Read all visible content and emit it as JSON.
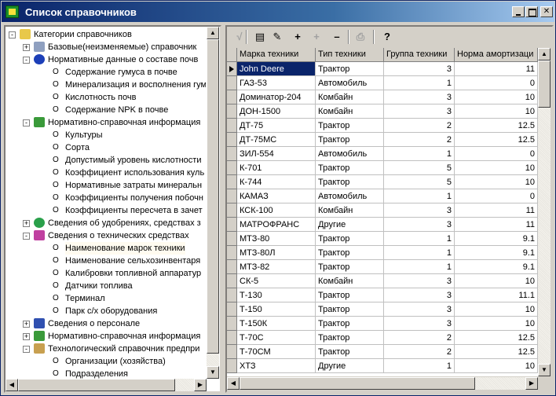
{
  "window": {
    "title": "Список справочников"
  },
  "tree": {
    "rows": [
      {
        "text": "Категории справочников",
        "level": 0,
        "exp": "-",
        "icon": "folder-open-icon"
      },
      {
        "text": "Базовые(неизменяемые) справочник",
        "level": 1,
        "exp": "+",
        "icon": "stack-icon"
      },
      {
        "text": "Нормативные данные о составе почв",
        "level": 1,
        "exp": "-",
        "icon": "drop-icon"
      },
      {
        "text": "Содержание гумуса в почве",
        "level": 2,
        "exp": "",
        "icon": ""
      },
      {
        "text": "Минерализация и восполнения гум",
        "level": 2,
        "exp": "",
        "icon": ""
      },
      {
        "text": "Кислотность почв",
        "level": 2,
        "exp": "",
        "icon": ""
      },
      {
        "text": "Содержание NPK в почве",
        "level": 2,
        "exp": "",
        "icon": ""
      },
      {
        "text": "Нормативно-справочная информация",
        "level": 1,
        "exp": "-",
        "icon": "plant-icon"
      },
      {
        "text": "Культуры",
        "level": 2,
        "exp": "",
        "icon": ""
      },
      {
        "text": "Сорта",
        "level": 2,
        "exp": "",
        "icon": ""
      },
      {
        "text": "Допустимый уровень кислотности",
        "level": 2,
        "exp": "",
        "icon": ""
      },
      {
        "text": "Коэффициент использования куль",
        "level": 2,
        "exp": "",
        "icon": ""
      },
      {
        "text": "Нормативные затраты минеральн",
        "level": 2,
        "exp": "",
        "icon": ""
      },
      {
        "text": "Коэффициенты получения побочн",
        "level": 2,
        "exp": "",
        "icon": ""
      },
      {
        "text": "Коэффициенты пересчета в зачет",
        "level": 2,
        "exp": "",
        "icon": ""
      },
      {
        "text": "Сведения об удобрениях, средствах з",
        "level": 1,
        "exp": "+",
        "icon": "green-drop-icon"
      },
      {
        "text": "Сведения о технических средствах",
        "level": 1,
        "exp": "-",
        "icon": "car-icon"
      },
      {
        "text": "Наименование марок техники",
        "level": 2,
        "exp": "",
        "icon": "",
        "highlight": true
      },
      {
        "text": "Наименование сельхозинвентаря",
        "level": 2,
        "exp": "",
        "icon": ""
      },
      {
        "text": "Калибровки топливной аппаратур",
        "level": 2,
        "exp": "",
        "icon": ""
      },
      {
        "text": "Датчики топлива",
        "level": 2,
        "exp": "",
        "icon": ""
      },
      {
        "text": "Терминал",
        "level": 2,
        "exp": "",
        "icon": ""
      },
      {
        "text": "Парк с/х оборудования",
        "level": 2,
        "exp": "",
        "icon": ""
      },
      {
        "text": "Сведения о персонале",
        "level": 1,
        "exp": "+",
        "icon": "person-icon"
      },
      {
        "text": "Нормативно-справочная информация",
        "level": 1,
        "exp": "+",
        "icon": "plant-pot-icon"
      },
      {
        "text": "Технологический справочник предпри",
        "level": 1,
        "exp": "-",
        "icon": "house-icon"
      },
      {
        "text": "Организации (хозяйства)",
        "level": 2,
        "exp": "",
        "icon": ""
      },
      {
        "text": "Подразделения",
        "level": 2,
        "exp": "",
        "icon": ""
      }
    ]
  },
  "toolbar": {
    "buttons": [
      {
        "name": "check-icon",
        "glyph": "√",
        "enabled": false
      },
      {
        "name": "list-icon",
        "glyph": "▤",
        "enabled": true
      },
      {
        "name": "edit-icon",
        "glyph": "✎",
        "enabled": true
      },
      {
        "name": "add-icon",
        "glyph": "+",
        "enabled": true
      },
      {
        "name": "add-copy-icon",
        "glyph": "+",
        "enabled": false
      },
      {
        "name": "delete-icon",
        "glyph": "–",
        "enabled": true
      },
      {
        "name": "print-icon",
        "glyph": "⎙",
        "enabled": false
      },
      {
        "name": "help-icon",
        "glyph": "?",
        "enabled": true
      }
    ]
  },
  "grid": {
    "columns": [
      "Марка техники",
      "Тип техники",
      "Группа техники",
      "Норма амортизаци"
    ],
    "rows": [
      [
        "John Deere",
        "Трактор",
        "3",
        "11"
      ],
      [
        "ГАЗ-53",
        "Автомобиль",
        "1",
        "0"
      ],
      [
        "Доминатор-204",
        "Комбайн",
        "3",
        "10"
      ],
      [
        "ДОН-1500",
        "Комбайн",
        "3",
        "10"
      ],
      [
        "ДТ-75",
        "Трактор",
        "2",
        "12.5"
      ],
      [
        "ДТ-75МС",
        "Трактор",
        "2",
        "12.5"
      ],
      [
        "ЗИЛ-554",
        "Автомобиль",
        "1",
        "0"
      ],
      [
        "К-701",
        "Трактор",
        "5",
        "10"
      ],
      [
        "К-744",
        "Трактор",
        "5",
        "10"
      ],
      [
        "КАМАЗ",
        "Автомобиль",
        "1",
        "0"
      ],
      [
        "КСК-100",
        "Комбайн",
        "3",
        "11"
      ],
      [
        "МАТРОФРАНС",
        "Другие",
        "3",
        "11"
      ],
      [
        "МТЗ-80",
        "Трактор",
        "1",
        "9.1"
      ],
      [
        "МТЗ-80Л",
        "Трактор",
        "1",
        "9.1"
      ],
      [
        "МТЗ-82",
        "Трактор",
        "1",
        "9.1"
      ],
      [
        "СК-5",
        "Комбайн",
        "3",
        "10"
      ],
      [
        "Т-130",
        "Трактор",
        "3",
        "11.1"
      ],
      [
        "Т-150",
        "Трактор",
        "3",
        "10"
      ],
      [
        "Т-150К",
        "Трактор",
        "3",
        "10"
      ],
      [
        "Т-70С",
        "Трактор",
        "2",
        "12.5"
      ],
      [
        "Т-70СМ",
        "Трактор",
        "2",
        "12.5"
      ],
      [
        "ХТЗ",
        "Другие",
        "1",
        "10"
      ]
    ],
    "selected_row": 0
  }
}
